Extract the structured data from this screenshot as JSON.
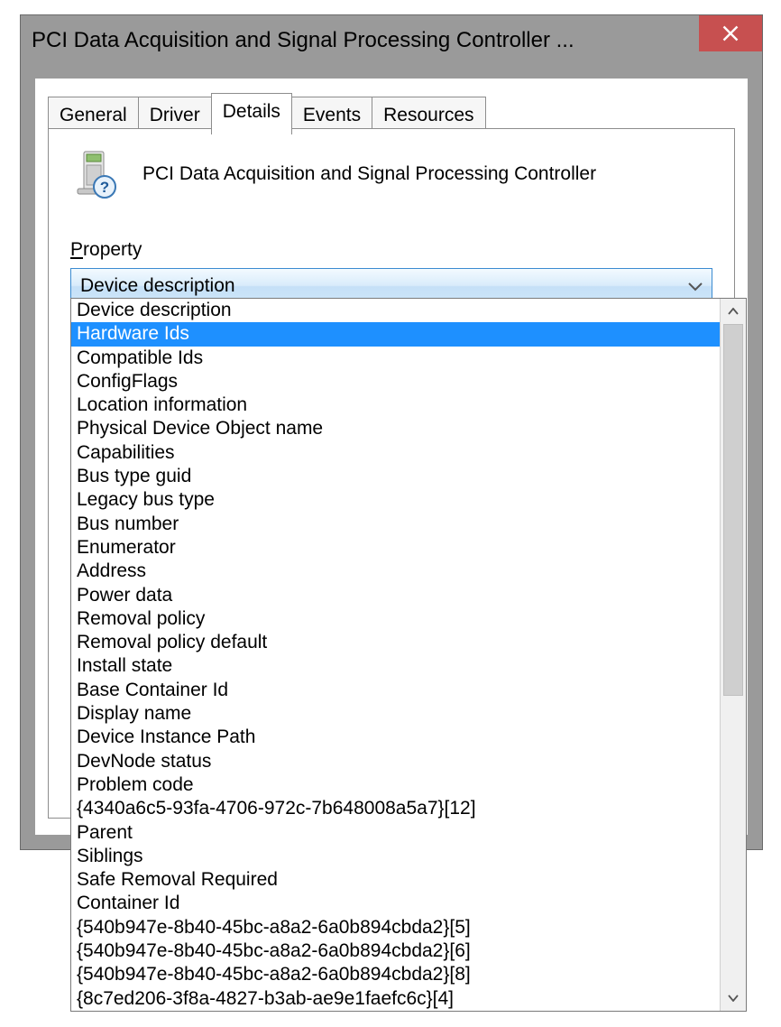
{
  "window": {
    "title": "PCI Data Acquisition and Signal Processing Controller ..."
  },
  "tabs": [
    {
      "label": "General"
    },
    {
      "label": "Driver"
    },
    {
      "label": "Details"
    },
    {
      "label": "Events"
    },
    {
      "label": "Resources"
    }
  ],
  "device": {
    "name": "PCI Data Acquisition and Signal Processing Controller"
  },
  "property_section_label_prefix": "P",
  "property_section_label_rest": "roperty",
  "combo_selected": "Device description",
  "dropdown_items": [
    "Device description",
    "Hardware Ids",
    "Compatible Ids",
    "ConfigFlags",
    "Location information",
    "Physical Device Object name",
    "Capabilities",
    "Bus type guid",
    "Legacy bus type",
    "Bus number",
    "Enumerator",
    "Address",
    "Power data",
    "Removal policy",
    "Removal policy default",
    "Install state",
    "Base Container Id",
    "Display name",
    "Device Instance Path",
    "DevNode status",
    "Problem code",
    "{4340a6c5-93fa-4706-972c-7b648008a5a7}[12]",
    "Parent",
    "Siblings",
    "Safe Removal Required",
    "Container Id",
    "{540b947e-8b40-45bc-a8a2-6a0b894cbda2}[5]",
    "{540b947e-8b40-45bc-a8a2-6a0b894cbda2}[6]",
    "{540b947e-8b40-45bc-a8a2-6a0b894cbda2}[8]",
    "{8c7ed206-3f8a-4827-b3ab-ae9e1faefc6c}[4]"
  ],
  "dropdown_selected_index": 1
}
